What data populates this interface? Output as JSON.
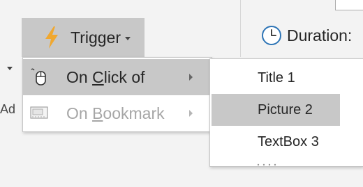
{
  "toolbar": {
    "trigger_label": "Trigger",
    "duration_label": "Duration:",
    "left_clipped_text": "Ad"
  },
  "menu": {
    "items": [
      {
        "label": "On Click of",
        "access_key": "C",
        "enabled": true,
        "highlighted": true,
        "icon": "mouse-icon"
      },
      {
        "label": "On Bookmark",
        "access_key": "B",
        "enabled": false,
        "highlighted": false,
        "icon": "bookmark-icon"
      }
    ]
  },
  "submenu": {
    "items": [
      {
        "label": "Title 1",
        "highlighted": false
      },
      {
        "label": "Picture 2",
        "highlighted": true
      },
      {
        "label": "TextBox 3",
        "highlighted": false
      }
    ]
  },
  "colors": {
    "ribbon_bg": "#f3f3f3",
    "highlight": "#c8c8c8",
    "bolt": "#f0a830",
    "clock": "#2e75b6",
    "disabled_text": "#a6a6a6"
  }
}
